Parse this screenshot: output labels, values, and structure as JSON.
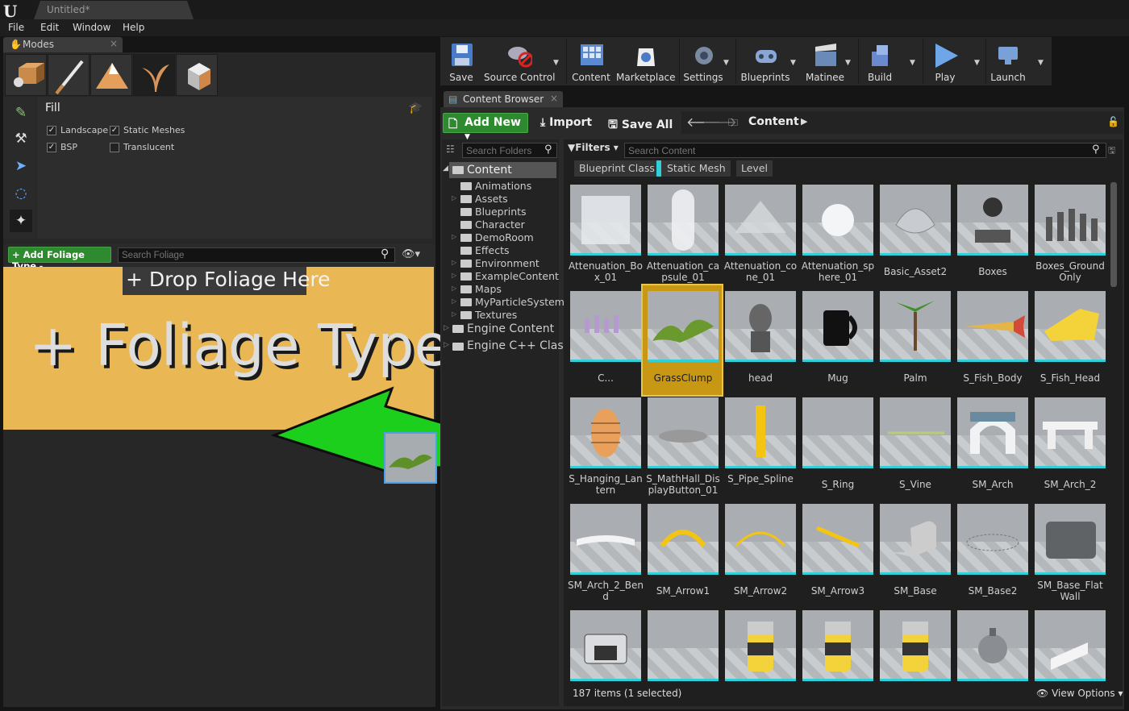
{
  "title_bar": {
    "logo": "U",
    "doc_tab": "Untitled*"
  },
  "menu": [
    "File",
    "Edit",
    "Window",
    "Help"
  ],
  "modes": {
    "tab_label": "Modes",
    "mode_icons": [
      "place-mode-icon",
      "paint-mode-icon",
      "landscape-mode-icon",
      "foliage-mode-icon",
      "geometry-mode-icon"
    ],
    "tool_icons": [
      "paint-tool-icon",
      "reapply-tool-icon",
      "select-tool-icon",
      "lasso-tool-icon",
      "fill-tool-icon"
    ],
    "fill": {
      "title": "Fill",
      "options": [
        {
          "label": "Landscape",
          "checked": true
        },
        {
          "label": "Static Meshes",
          "checked": true
        },
        {
          "label": "BSP",
          "checked": true
        },
        {
          "label": "Translucent",
          "checked": false
        }
      ]
    },
    "add_foliage_label": "+ Add Foliage Type",
    "search_foliage_placeholder": "Search Foliage",
    "drop_hint": "+ Drop Foliage Here",
    "foliage_type_text": "+ Foliage Type",
    "drop_area_color": "#e9b855"
  },
  "toolbar": [
    {
      "label": "Save",
      "icon": "save-icon"
    },
    {
      "label": "Source Control",
      "icon": "source-control-icon"
    },
    {
      "label": "Content",
      "icon": "content-icon"
    },
    {
      "label": "Marketplace",
      "icon": "marketplace-icon"
    },
    {
      "label": "Settings",
      "icon": "settings-icon"
    },
    {
      "label": "Blueprints",
      "icon": "blueprints-icon"
    },
    {
      "label": "Matinee",
      "icon": "matinee-icon"
    },
    {
      "label": "Build",
      "icon": "build-icon"
    },
    {
      "label": "Play",
      "icon": "play-icon"
    },
    {
      "label": "Launch",
      "icon": "launch-icon"
    }
  ],
  "content_browser": {
    "tab_label": "Content Browser",
    "add_new_label": "Add New",
    "import_label": "Import",
    "save_all_label": "Save All",
    "breadcrumb": "Content",
    "search_folders_placeholder": "Search Folders",
    "search_content_placeholder": "Search Content",
    "filters_label": "Filters",
    "filter_chips": [
      "Blueprint Class",
      "Static Mesh",
      "Level"
    ],
    "folders": {
      "root": "Content",
      "children": [
        "Animations",
        "Assets",
        "Blueprints",
        "Character",
        "DemoRoom",
        "Effects",
        "Environment",
        "ExampleContent",
        "Maps",
        "MyParticleSystem",
        "Textures"
      ],
      "engine": [
        "Engine Content",
        "Engine C++ Clas"
      ]
    },
    "assets": [
      "Attenuation_Box_01",
      "Attenuation_capsule_01",
      "Attenuation_cone_01",
      "Attenuation_sphere_01",
      "Basic_Asset2",
      "Boxes",
      "Boxes_Ground Only",
      "C...",
      "GrassClump",
      "head",
      "Mug",
      "Palm",
      "S_Fish_Body",
      "S_Fish_Head",
      "S_Hanging_Lantern",
      "S_MathHall_DisplayButton_01",
      "S_Pipe_Spline",
      "S_Ring",
      "S_Vine",
      "SM_Arch",
      "SM_Arch_2",
      "SM_Arch_2_Bend",
      "SM_Arrow1",
      "SM_Arrow2",
      "SM_Arrow3",
      "SM_Base",
      "SM_Base2",
      "SM_Base_Flat Wall",
      "",
      "",
      "",
      "",
      "",
      "",
      ""
    ],
    "selected_asset": "GrassClump",
    "status": "187 items (1 selected)",
    "view_options_label": "View Options"
  }
}
